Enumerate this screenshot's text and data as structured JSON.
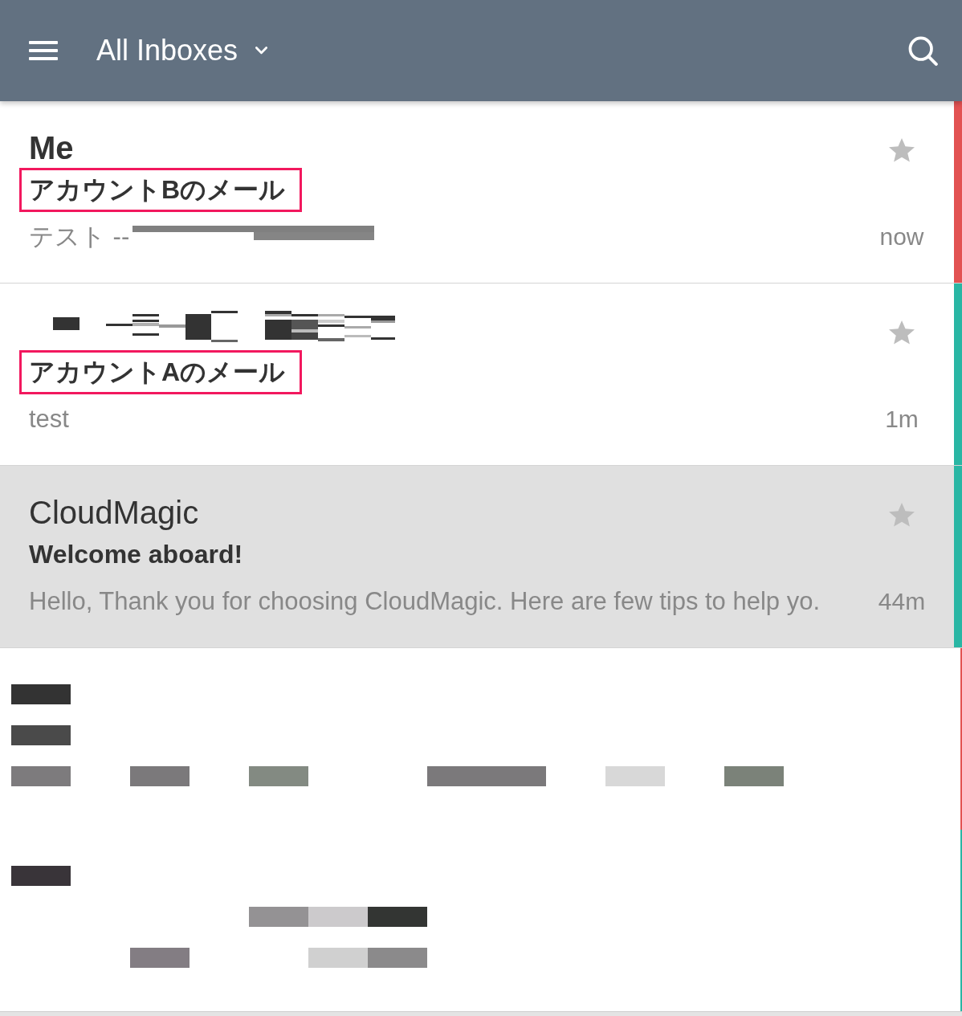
{
  "header": {
    "title": "All Inboxes"
  },
  "emails": [
    {
      "kind": "message",
      "sender": "Me",
      "unread": true,
      "subject": "アカウントBのメール",
      "subject_annotated": true,
      "preview": "テスト --",
      "preview_redacted": true,
      "time": "now",
      "starred": false,
      "color": "#e25252"
    },
    {
      "kind": "message",
      "sender_pixelated": true,
      "unread": true,
      "subject": "アカウントAのメール",
      "subject_annotated": true,
      "preview": "test",
      "time": "1m",
      "starred": false,
      "color": "#29b6a4"
    },
    {
      "kind": "message",
      "sender": "CloudMagic",
      "unread": false,
      "subject": "Welcome aboard!",
      "subject_annotated": false,
      "preview": "Hello, Thank you for choosing CloudMagic. Here are few tips to help yo.",
      "time": "44m",
      "starred": false,
      "color": "#29b6a4"
    },
    {
      "kind": "pixelated",
      "unread": true,
      "color": "#e25252"
    },
    {
      "kind": "pixelated",
      "unread": true,
      "color": "#29b6a4"
    }
  ]
}
